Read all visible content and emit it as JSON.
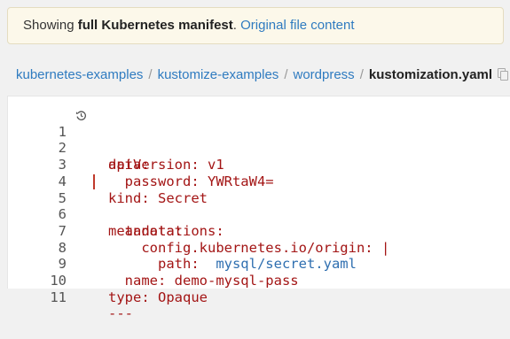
{
  "notice": {
    "prefix": "Showing ",
    "bold": "full Kubernetes manifest",
    "suffix": ". ",
    "link": "Original file content"
  },
  "breadcrumb": {
    "items": [
      "kubernetes-examples",
      "kustomize-examples",
      "wordpress"
    ],
    "separator": "/",
    "current": "kustomization.yaml"
  },
  "code": {
    "lines": [
      {
        "num": "1",
        "text": "apiVersion: v1"
      },
      {
        "num": "2",
        "text": "data:"
      },
      {
        "num": "3",
        "text": "  password: YWRtaW4="
      },
      {
        "num": "4",
        "text": "kind: Secret"
      },
      {
        "num": "5",
        "text": "metadata:"
      },
      {
        "num": "6",
        "text": "  annotations:"
      },
      {
        "num": "7",
        "text": "    config.kubernetes.io/origin: |"
      },
      {
        "num": "8",
        "key": "      path: ",
        "value": " mysql/secret.yaml"
      },
      {
        "num": "9",
        "text": "  name: demo-mysql-pass"
      },
      {
        "num": "10",
        "text": "type: Opaque"
      },
      {
        "num": "11",
        "text": "---"
      }
    ]
  },
  "colors": {
    "code_text": "#a31515",
    "string_value": "#2f6fb0",
    "link": "#2f7bc0",
    "notice_bg": "#fcf8ea",
    "change_marker": "#c0392b"
  },
  "icons": {
    "history": "history-icon",
    "copy": "copy-icon"
  }
}
